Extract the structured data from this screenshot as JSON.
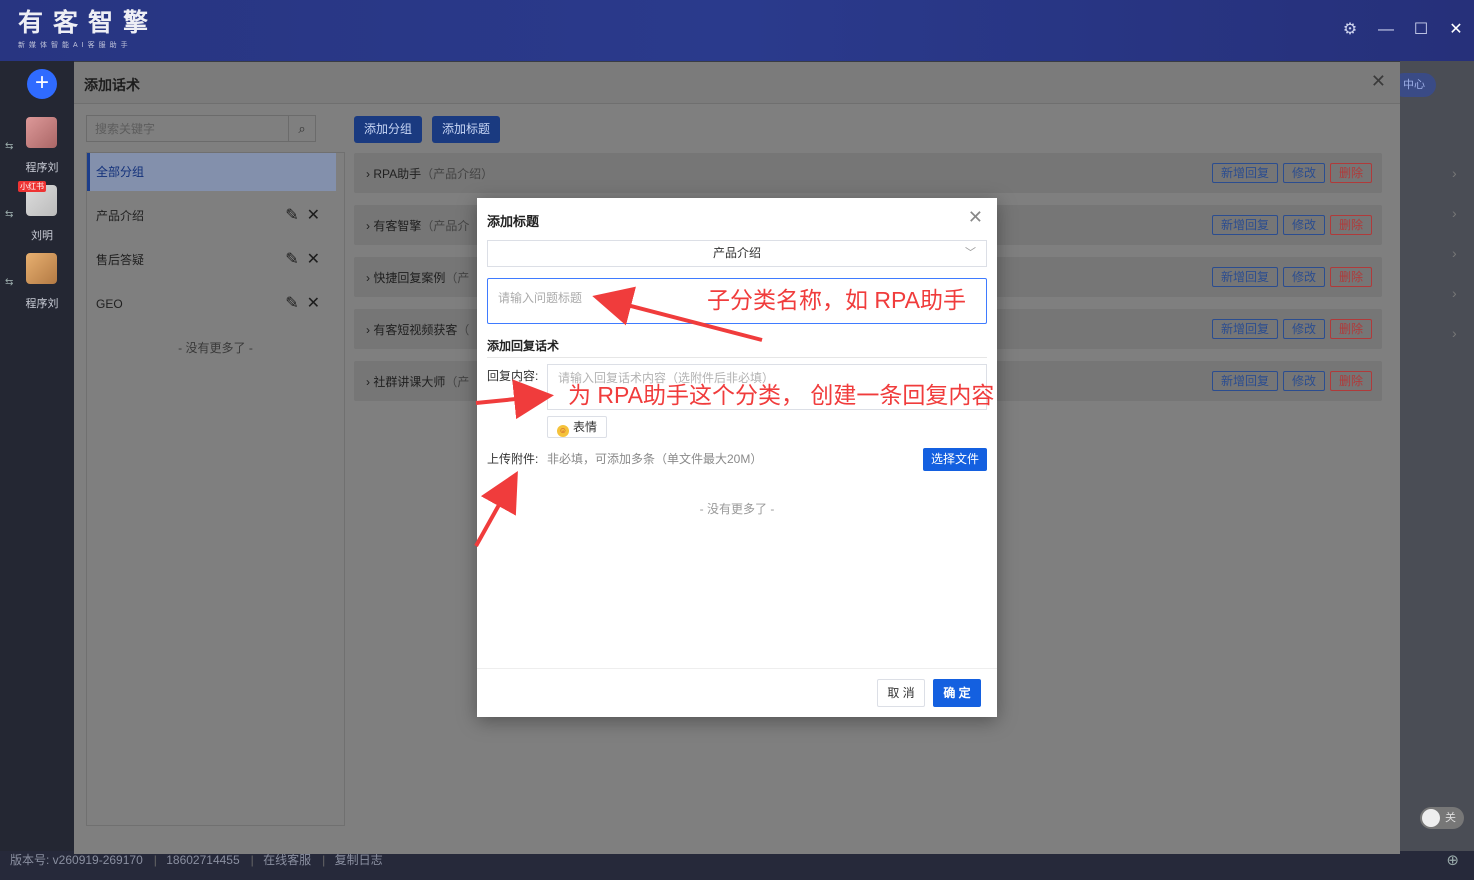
{
  "app": {
    "brand_name": "有客智擎",
    "brand_tagline": "新媒体智能AI客服助手",
    "window_controls": {
      "settings": "⚙",
      "minimize": "—",
      "maximize": "☐",
      "close": "✕"
    }
  },
  "sidebar": {
    "add_label": "+",
    "accounts": [
      {
        "name": "程序刘",
        "tag": ""
      },
      {
        "name": "刘明",
        "tag": "小红书"
      },
      {
        "name": "程序刘",
        "tag": ""
      }
    ],
    "swap_icon": "⇆"
  },
  "background_right": {
    "pill": "中心",
    "chevrons": [
      "›",
      "›",
      "›",
      "›",
      "›"
    ],
    "toggle": "关"
  },
  "statusbar": {
    "version": "版本号: v260919-269170",
    "phone": "18602714455",
    "service": "在线客服",
    "log": "复制日志"
  },
  "big_dialog": {
    "title": "添加话术",
    "close": "✕",
    "search_placeholder": "搜索关键字",
    "add_group_label": "添加分组",
    "add_title_label": "添加标题",
    "groups": [
      {
        "label": "全部分组",
        "active": true
      },
      {
        "label": "产品介绍",
        "active": false
      },
      {
        "label": "售后答疑",
        "active": false
      },
      {
        "label": "GEO",
        "active": false
      }
    ],
    "group_edit_icon": "✎",
    "group_delete_icon": "✕",
    "no_more": "- 没有更多了 -",
    "title_rows": [
      {
        "title": "RPA助手",
        "sub": "（产品介绍）"
      },
      {
        "title": "有客智擎",
        "sub": "（产品介"
      },
      {
        "title": "快捷回复案例",
        "sub": "（产"
      },
      {
        "title": "有客短视频获客",
        "sub": "（"
      },
      {
        "title": "社群讲课大师",
        "sub": "（产"
      }
    ],
    "row_buttons": {
      "add_reply": "新增回复",
      "edit": "修改",
      "delete": "删除"
    }
  },
  "modal": {
    "title": "添加标题",
    "close": "✕",
    "category_value": "产品介绍",
    "title_placeholder": "请输入问题标题",
    "section_label": "添加回复话术",
    "reply_label": "回复内容:",
    "reply_placeholder": "请输入回复话术内容（选附件后非必填）",
    "emoji_label": "表情",
    "attach_label": "上传附件:",
    "attach_hint": "非必填，可添加多条（单文件最大20M）",
    "choose_file_label": "选择文件",
    "no_more": "- 没有更多了 -",
    "cancel_label": "取 消",
    "ok_label": "确 定"
  },
  "annotations": {
    "note1": "子分类名称，如 RPA助手",
    "note2": "为 RPA助手这个分类，  创建一条回复内容",
    "color": "#f03c3c"
  }
}
